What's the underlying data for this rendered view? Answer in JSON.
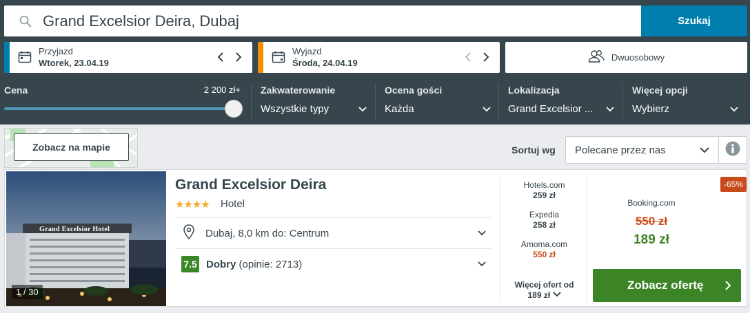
{
  "search": {
    "query": "Grand Excelsior Deira, Dubaj",
    "button_label": "Szukaj",
    "icon": "search-icon"
  },
  "dates": {
    "checkin": {
      "label": "Przyjazd",
      "value": "Wtorek, 23.04.19",
      "accent": "#007faf"
    },
    "checkout": {
      "label": "Wyjazd",
      "value": "Środa, 24.04.19",
      "accent": "#f48f00"
    }
  },
  "room": {
    "label": "Dwuosobowy",
    "icon": "users-icon"
  },
  "filters": {
    "price": {
      "label": "Cena",
      "max": "2 200 zł+",
      "level": 1.0
    },
    "accommodation": {
      "label": "Zakwaterowanie",
      "value": "Wszystkie typy"
    },
    "guest_rating": {
      "label": "Ocena gości",
      "value": "Każda"
    },
    "location": {
      "label": "Lokalizacja",
      "value": "Grand Excelsior ..."
    },
    "more": {
      "label": "Więcej opcji",
      "value": "Wybierz"
    }
  },
  "map": {
    "button_label": "Zobacz na mapie"
  },
  "sort": {
    "label": "Sortuj wg",
    "value": "Polecane przez nas"
  },
  "hotel": {
    "photo_count": "1 / 30",
    "photo_sign": "Grand Excelsior Hotel",
    "name": "Grand Excelsior Deira",
    "stars": "★★★★",
    "type": "Hotel",
    "location": "Dubaj, 8,0 km do: Centrum",
    "rating_score": "7.5",
    "rating_word": "Dobry",
    "rating_reviews": "(opinie: 2713)"
  },
  "offers": [
    {
      "provider": "Hotels.com",
      "price": "259 zł"
    },
    {
      "provider": "Expedia",
      "price": "258 zł"
    },
    {
      "provider": "Amoma.com",
      "price": "550 zł"
    }
  ],
  "more_offers": {
    "label": "Więcej ofert od",
    "price": "189 zł"
  },
  "deal": {
    "discount": "-65%",
    "provider": "Booking.com",
    "old_price": "550 zł",
    "new_price": "189 zł",
    "cta_label": "Zobacz ofertę"
  }
}
